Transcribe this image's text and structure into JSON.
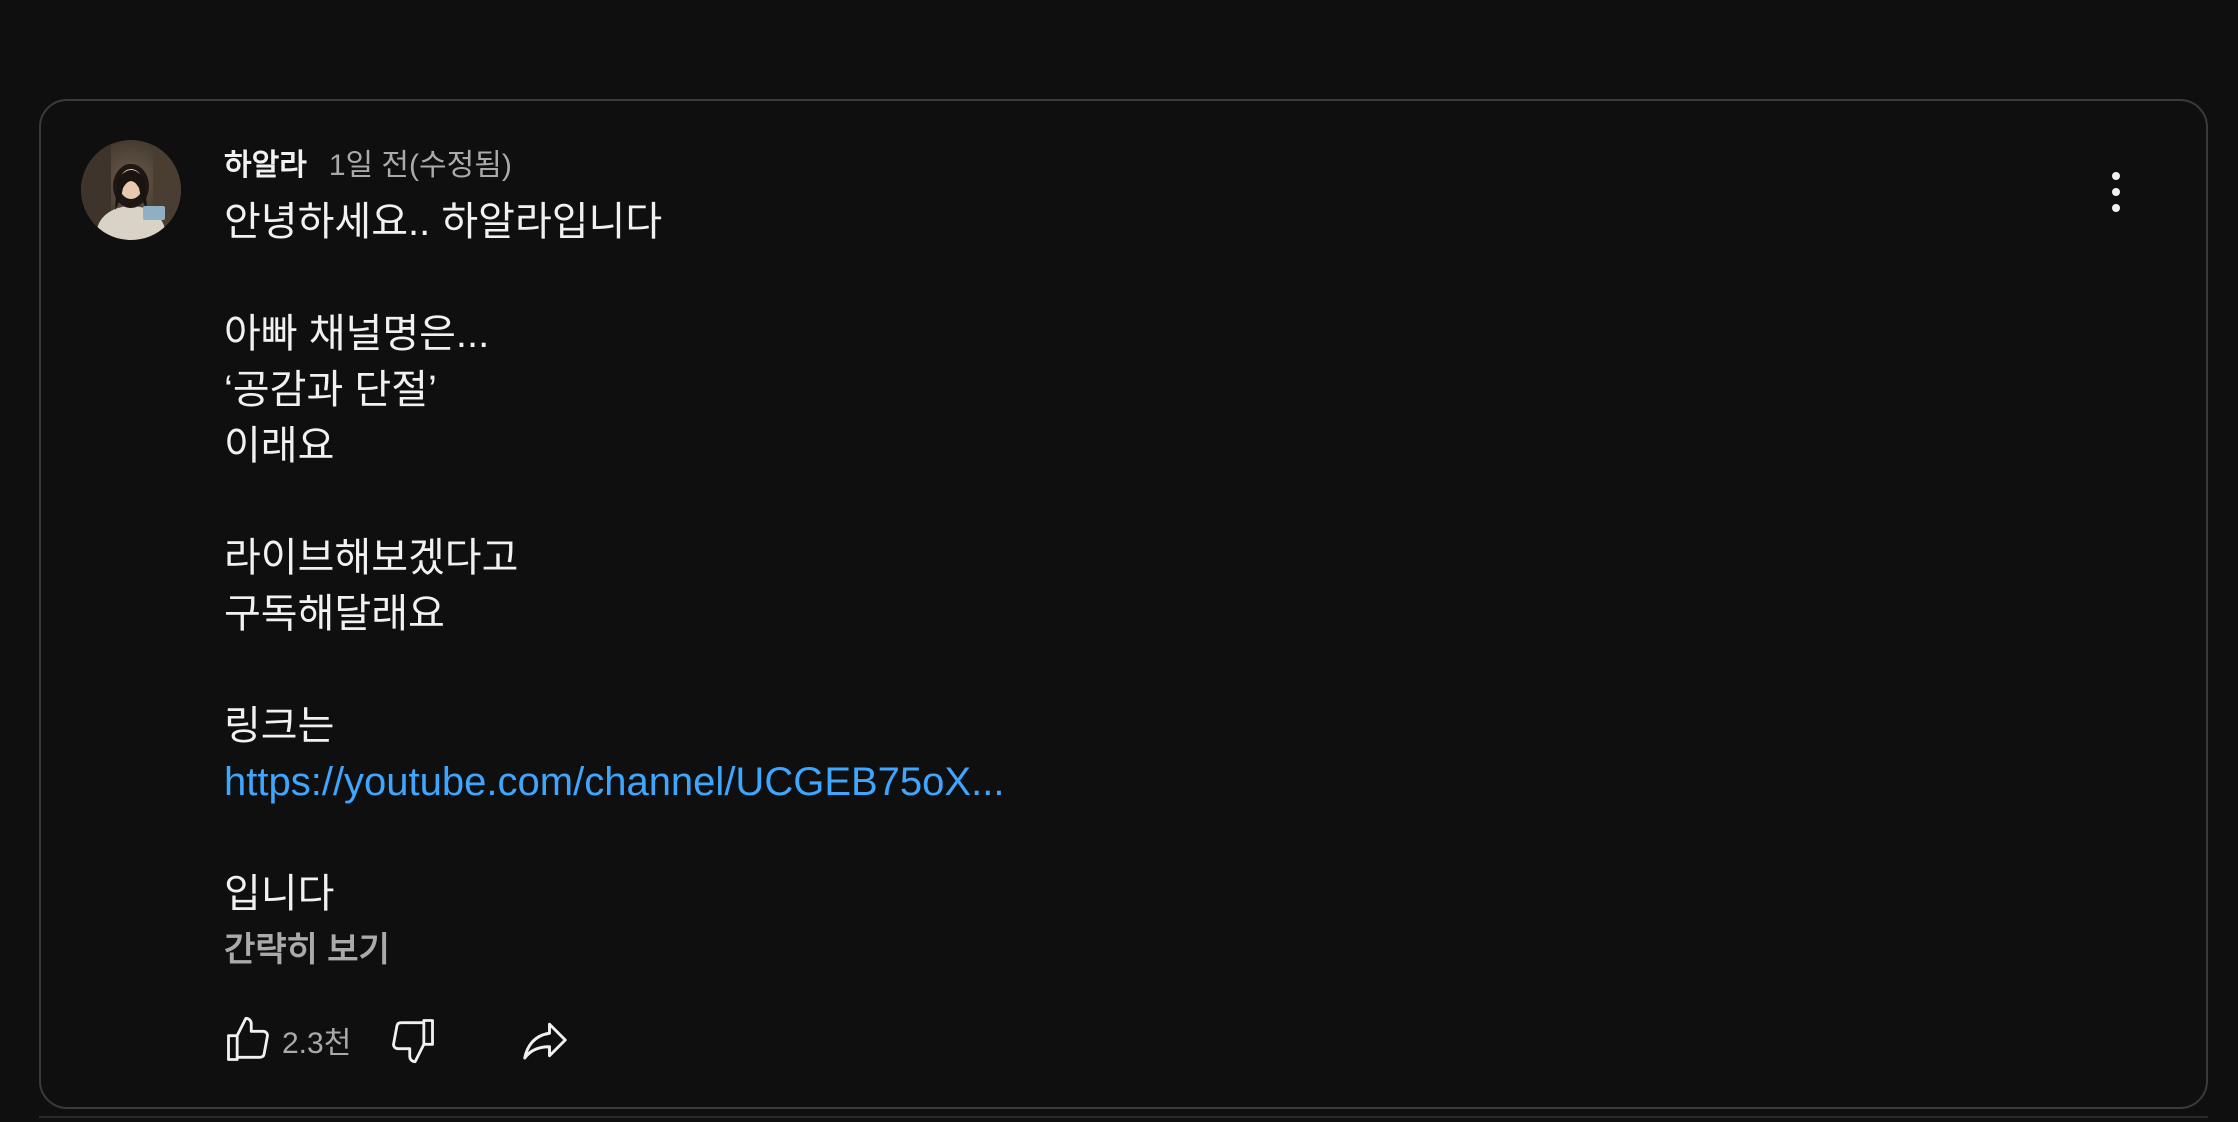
{
  "comment": {
    "author": "하알라",
    "timestamp": "1일 전(수정됨)",
    "lines": [
      "안녕하세요.. 하알라입니다",
      "",
      "아빠 채널명은...",
      "‘공감과 단절’",
      "이래요",
      "",
      "라이브해보겠다고",
      "구독해달래요",
      "",
      "링크는"
    ],
    "link_text": "https://youtube.com/channel/UCGEB75oX...",
    "closing_lines": [
      "",
      "입니다"
    ],
    "show_less_label": "간략히 보기",
    "like_count": "2.3천"
  },
  "icons": {
    "avatar": "avatar-image",
    "more": "more-vertical-icon",
    "like": "thumbs-up-icon",
    "dislike": "thumbs-down-icon",
    "share": "share-icon"
  },
  "colors": {
    "background": "#0f0f0f",
    "text": "#f1f1f1",
    "secondary_text": "#aaaaaa",
    "link": "#3ea6ff",
    "border": "#3a3a3a"
  }
}
